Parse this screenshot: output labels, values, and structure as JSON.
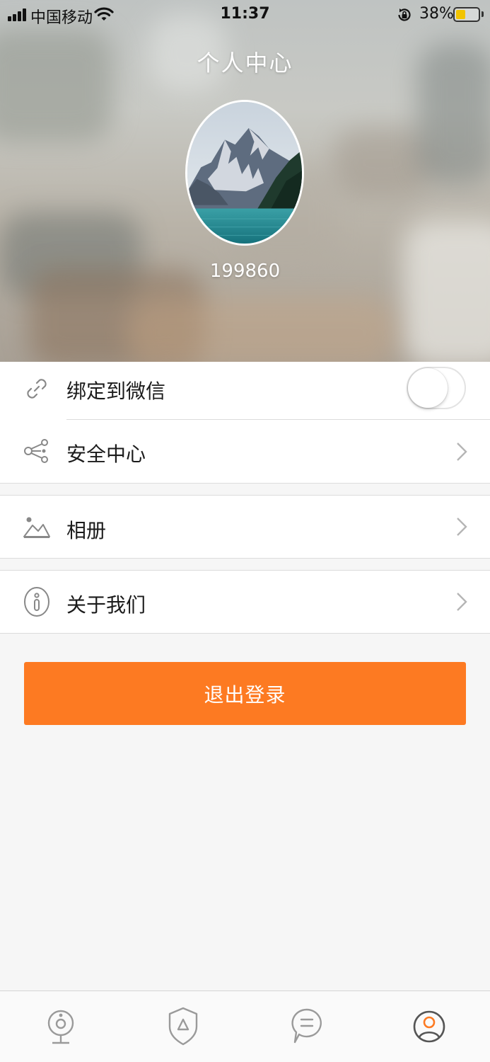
{
  "status_bar": {
    "carrier": "中国移动",
    "time": "11:37",
    "battery_percent": "38%",
    "battery_level": 0.38,
    "battery_color": "#f2c400"
  },
  "header": {
    "title": "个人中心",
    "username": "199860"
  },
  "menu": {
    "wechat": {
      "label": "绑定到微信",
      "icon": "link-icon",
      "toggle_on": false
    },
    "security": {
      "label": "安全中心",
      "icon": "share-nodes-icon"
    },
    "album": {
      "label": "相册",
      "icon": "mountain-image-icon"
    },
    "about": {
      "label": "关于我们",
      "icon": "info-icon"
    }
  },
  "logout": {
    "label": "退出登录",
    "color": "#fd7a22"
  },
  "tabbar": {
    "items": [
      {
        "icon": "camera-icon",
        "active": false
      },
      {
        "icon": "shield-icon",
        "active": false
      },
      {
        "icon": "message-icon",
        "active": false
      },
      {
        "icon": "user-icon",
        "active": true
      }
    ],
    "active_color": "#fd7a22"
  }
}
